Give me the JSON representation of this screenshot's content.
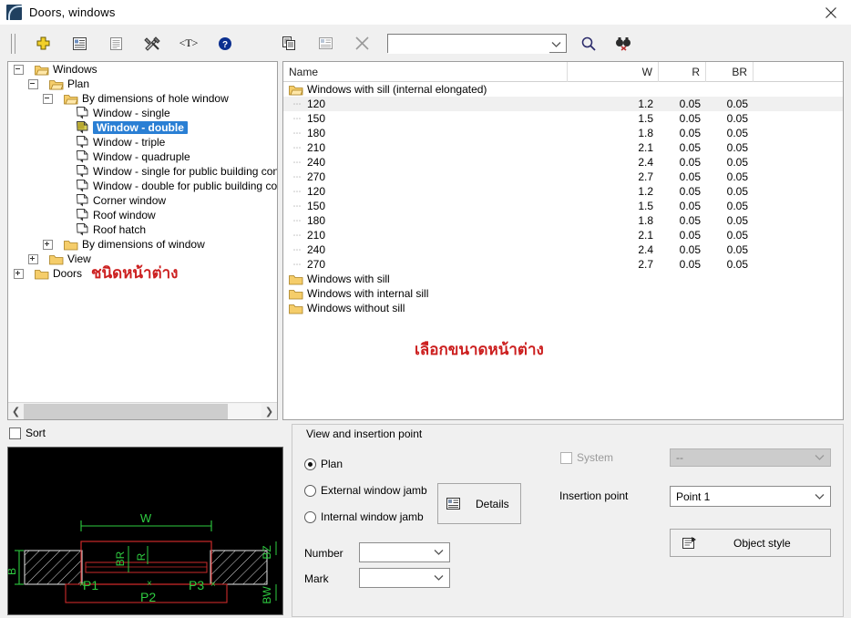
{
  "window": {
    "title": "Doors, windows",
    "app_icon": "window-arc-icon",
    "close_label": "✕"
  },
  "toolbar": {
    "items": [
      {
        "name": "grip-handle",
        "icon": "grip-icon",
        "label": ""
      },
      {
        "name": "add-button",
        "icon": "plus-cross-icon",
        "label": ""
      },
      {
        "name": "properties-button",
        "icon": "list-properties-icon",
        "label": ""
      },
      {
        "name": "document-button",
        "icon": "document-icon",
        "label": ""
      },
      {
        "name": "tools-button",
        "icon": "hammer-wrench-icon",
        "label": ""
      },
      {
        "name": "text-button",
        "icon": "text-brackets-icon",
        "label": ""
      },
      {
        "name": "help-button",
        "icon": "question-mark-icon",
        "label": ""
      },
      {
        "name": "copy-button",
        "icon": "copy-pages-icon",
        "label": ""
      },
      {
        "name": "table-button",
        "icon": "table-grid-icon",
        "label": ""
      },
      {
        "name": "delete-button",
        "icon": "x-cross-icon",
        "label": ""
      }
    ],
    "search_value": "",
    "search_placeholder": "",
    "find_icon": "magnifier-icon",
    "find_next_icon": "binoculars-icon"
  },
  "tree": {
    "nodes": [
      {
        "label": "Windows",
        "depth": 0,
        "toggle": "minus",
        "icon": "folder-open-icon",
        "selected": false
      },
      {
        "label": "Plan",
        "depth": 1,
        "toggle": "minus",
        "icon": "folder-open-icon",
        "selected": false
      },
      {
        "label": "By dimensions of hole window",
        "depth": 2,
        "toggle": "minus",
        "icon": "folder-open-icon",
        "selected": false
      },
      {
        "label": "Window - single",
        "depth": 3,
        "toggle": "none",
        "icon": "block-doc-icon",
        "selected": false
      },
      {
        "label": "Window - double",
        "depth": 3,
        "toggle": "none",
        "icon": "block-doc-icon",
        "selected": true
      },
      {
        "label": "Window - triple",
        "depth": 3,
        "toggle": "none",
        "icon": "block-doc-icon",
        "selected": false
      },
      {
        "label": "Window - quadruple",
        "depth": 3,
        "toggle": "none",
        "icon": "block-doc-icon",
        "selected": false
      },
      {
        "label": "Window - single for public building constr",
        "depth": 3,
        "toggle": "none",
        "icon": "block-doc-icon",
        "selected": false
      },
      {
        "label": "Window - double for public building cons",
        "depth": 3,
        "toggle": "none",
        "icon": "block-doc-icon",
        "selected": false
      },
      {
        "label": "Corner window",
        "depth": 3,
        "toggle": "none",
        "icon": "block-doc-icon",
        "selected": false
      },
      {
        "label": "Roof window",
        "depth": 3,
        "toggle": "none",
        "icon": "block-doc-icon",
        "selected": false
      },
      {
        "label": "Roof hatch",
        "depth": 3,
        "toggle": "none",
        "icon": "block-doc-icon",
        "selected": false
      },
      {
        "label": "By dimensions of window",
        "depth": 2,
        "toggle": "plus",
        "icon": "folder-icon",
        "selected": false
      },
      {
        "label": "View",
        "depth": 1,
        "toggle": "plus",
        "icon": "folder-icon",
        "selected": false
      },
      {
        "label": "Doors",
        "depth": 0,
        "toggle": "plus",
        "icon": "folder-icon",
        "selected": false
      }
    ],
    "annotation": "ชนิดหน้าต่าง",
    "annotation_color": "#cc1f1f",
    "scroll_left_icon": "chevron-left-icon",
    "scroll_right_icon": "chevron-right-icon"
  },
  "list": {
    "columns": [
      "Name",
      "W",
      "R",
      "BR"
    ],
    "group_label": "Windows with sill (internal elongated)",
    "rows": [
      {
        "name": "120",
        "w": "1.2",
        "r": "0.05",
        "br": "0.05",
        "highlight": true
      },
      {
        "name": "150",
        "w": "1.5",
        "r": "0.05",
        "br": "0.05",
        "highlight": false
      },
      {
        "name": "180",
        "w": "1.8",
        "r": "0.05",
        "br": "0.05",
        "highlight": false
      },
      {
        "name": "210",
        "w": "2.1",
        "r": "0.05",
        "br": "0.05",
        "highlight": false
      },
      {
        "name": "240",
        "w": "2.4",
        "r": "0.05",
        "br": "0.05",
        "highlight": false
      },
      {
        "name": "270",
        "w": "2.7",
        "r": "0.05",
        "br": "0.05",
        "highlight": false
      },
      {
        "name": "120",
        "w": "1.2",
        "r": "0.05",
        "br": "0.05",
        "highlight": false
      },
      {
        "name": "150",
        "w": "1.5",
        "r": "0.05",
        "br": "0.05",
        "highlight": false
      },
      {
        "name": "180",
        "w": "1.8",
        "r": "0.05",
        "br": "0.05",
        "highlight": false
      },
      {
        "name": "210",
        "w": "2.1",
        "r": "0.05",
        "br": "0.05",
        "highlight": false
      },
      {
        "name": "240",
        "w": "2.4",
        "r": "0.05",
        "br": "0.05",
        "highlight": false
      },
      {
        "name": "270",
        "w": "2.7",
        "r": "0.05",
        "br": "0.05",
        "highlight": false
      }
    ],
    "folders": [
      "Windows with sill",
      "Windows with internal sill",
      "Windows without sill"
    ],
    "annotation": "เลือกขนาดหน้าต่าง",
    "annotation_color": "#cc1f1f"
  },
  "sort": {
    "label": "Sort",
    "checked": false
  },
  "preview": {
    "labels": [
      "W",
      "BR",
      "R",
      "B",
      "P1",
      "P2",
      "P3",
      "BZ",
      "BW"
    ],
    "line_color": "#cc2a2a",
    "dim_color": "#2ecc40",
    "background": "#000000"
  },
  "bottom": {
    "group_title": "View and insertion point",
    "radios": [
      {
        "label": "Plan",
        "selected": true
      },
      {
        "label": "External window jamb",
        "selected": false
      },
      {
        "label": "Internal window jamb",
        "selected": false
      }
    ],
    "details_button": {
      "label": "Details",
      "icon": "details-table-icon"
    },
    "number_label": "Number",
    "number_value": "",
    "mark_label": "Mark",
    "mark_value": "",
    "system_label": "System",
    "system_checked": false,
    "system_value": "--",
    "insertion_point_label": "Insertion point",
    "insertion_point_value": "Point 1",
    "object_style_button": {
      "label": "Object style",
      "icon": "object-style-icon"
    }
  }
}
